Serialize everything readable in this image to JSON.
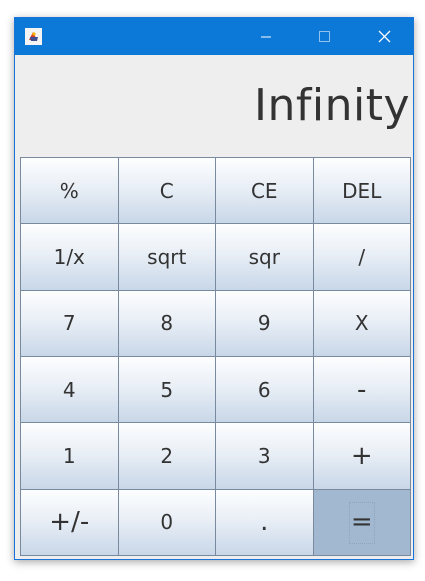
{
  "window": {
    "title": ""
  },
  "display": {
    "value": "Infinity"
  },
  "keypad": {
    "rows": [
      [
        "%",
        "C",
        "CE",
        "DEL"
      ],
      [
        "1/x",
        "sqrt",
        "sqr",
        "/"
      ],
      [
        "7",
        "8",
        "9",
        "X"
      ],
      [
        "4",
        "5",
        "6",
        "-"
      ],
      [
        "1",
        "2",
        "3",
        "+"
      ],
      [
        "+/-",
        "0",
        ".",
        "="
      ]
    ]
  },
  "colors": {
    "titlebar": "#0c78d8",
    "window_bg": "#eeeeee",
    "equals_key": "#a2b8d1",
    "text": "#333333"
  },
  "icons": {
    "app": "java-app-icon",
    "minimize": "minimize-icon",
    "maximize": "maximize-icon",
    "close": "close-icon"
  }
}
